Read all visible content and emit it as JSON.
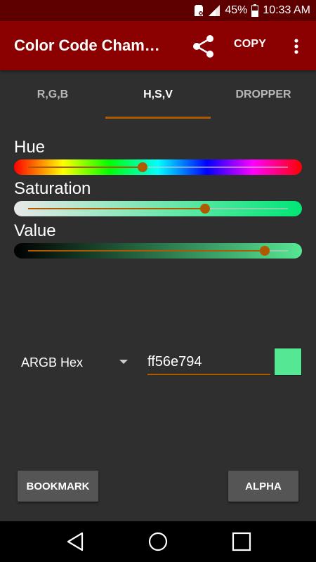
{
  "status_bar": {
    "battery_percent": "45%",
    "time": "10:33 AM",
    "icons": [
      "sd-card-icon",
      "signal-icon",
      "battery-icon"
    ]
  },
  "app_bar": {
    "title": "Color Code Chameleon",
    "copy_label": "COPY",
    "icons": [
      "share-icon",
      "more-vert-icon"
    ]
  },
  "tabs": [
    {
      "label": "R,G,B",
      "active": false
    },
    {
      "label": "H,S,V",
      "active": true
    },
    {
      "label": "DROPPER",
      "active": false
    }
  ],
  "sliders": {
    "hue": {
      "label": "Hue",
      "value_fraction": 0.44
    },
    "saturation": {
      "label": "Saturation",
      "value_fraction": 0.68
    },
    "value": {
      "label": "Value",
      "value_fraction": 0.91
    }
  },
  "format": {
    "selected": "ARGB Hex"
  },
  "hex_input": {
    "value": "ff56e794"
  },
  "swatch_color": "#56e794",
  "accent_color": "#b05a00",
  "buttons": {
    "bookmark": "BOOKMARK",
    "alpha": "ALPHA"
  },
  "nav_bar": {
    "icons": [
      "back-icon",
      "home-icon",
      "recents-icon"
    ]
  }
}
